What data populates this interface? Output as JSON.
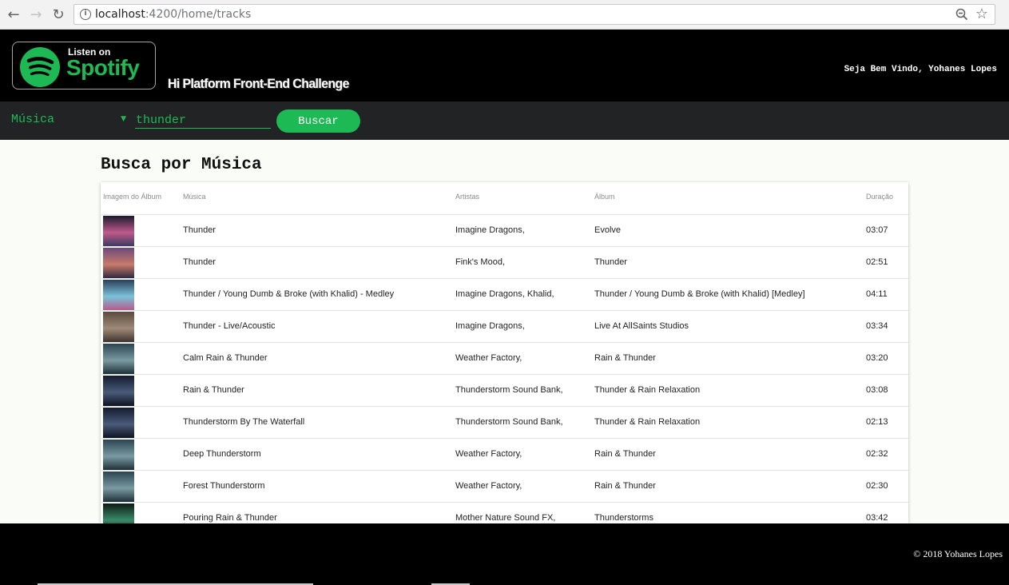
{
  "browser": {
    "url_host": "localhost",
    "url_path": ":4200/home/tracks"
  },
  "header": {
    "badge_small": "Listen on",
    "badge_big": "Spotify",
    "title": "Hi Platform Front-End Challenge",
    "welcome": "Seja Bem Vindo, Yohanes Lopes"
  },
  "search": {
    "type_selected": "Música",
    "query": "thunder",
    "button_label": "Buscar"
  },
  "main": {
    "title": "Busca por Música",
    "columns": [
      "Imagem do Álbum",
      "Música",
      "Artistas",
      "Álbum",
      "Duração"
    ],
    "rows": [
      {
        "name": "Thunder",
        "artists": "Imagine Dragons,",
        "album": "Evolve",
        "duration": "03:07",
        "thumb": [
          "#1a1a2e",
          "#c05a8a",
          "#3a3a60"
        ]
      },
      {
        "name": "Thunder",
        "artists": "Fink's Mood,",
        "album": "Thunder",
        "duration": "02:51",
        "thumb": [
          "#6a4a7a",
          "#c97a6a",
          "#2e2a40"
        ]
      },
      {
        "name": "Thunder / Young Dumb & Broke (with Khalid) - Medley",
        "artists": "Imagine Dragons, Khalid,",
        "album": "Thunder / Young Dumb & Broke (with Khalid) [Medley]",
        "duration": "04:11",
        "thumb": [
          "#2a3f5a",
          "#79c3d8",
          "#b85a8a"
        ]
      },
      {
        "name": "Thunder - Live/Acoustic",
        "artists": "Imagine Dragons,",
        "album": "Live At AllSaints Studios",
        "duration": "03:34",
        "thumb": [
          "#5a4a3e",
          "#a08a78",
          "#3e3430"
        ]
      },
      {
        "name": "Calm Rain & Thunder",
        "artists": "Weather Factory,",
        "album": "Rain & Thunder",
        "duration": "03:20",
        "thumb": [
          "#2b4550",
          "#7a9aa2",
          "#1e3038"
        ]
      },
      {
        "name": "Rain & Thunder",
        "artists": "Thunderstorm Sound Bank,",
        "album": "Thunder & Rain Relaxation",
        "duration": "03:08",
        "thumb": [
          "#141c2e",
          "#4a5a7a",
          "#0e1420"
        ]
      },
      {
        "name": "Thunderstorm By The Waterfall",
        "artists": "Thunderstorm Sound Bank,",
        "album": "Thunder & Rain Relaxation",
        "duration": "02:13",
        "thumb": [
          "#141c2e",
          "#4a5a7a",
          "#0e1420"
        ]
      },
      {
        "name": "Deep Thunderstorm",
        "artists": "Weather Factory,",
        "album": "Rain & Thunder",
        "duration": "02:32",
        "thumb": [
          "#2b4550",
          "#7a9aa2",
          "#1e3038"
        ]
      },
      {
        "name": "Forest Thunderstorm",
        "artists": "Weather Factory,",
        "album": "Rain & Thunder",
        "duration": "02:30",
        "thumb": [
          "#2b4550",
          "#7a9aa2",
          "#1e3038"
        ]
      },
      {
        "name": "Pouring Rain & Thunder",
        "artists": "Mother Nature Sound FX,",
        "album": "Thunderstorms",
        "duration": "03:42",
        "thumb": [
          "#0c1a14",
          "#3a8a6a",
          "#0a120e"
        ]
      }
    ]
  },
  "footer": {
    "copyright": "© 2018 Yohanes Lopes"
  },
  "colors": {
    "brand_green": "#1db954",
    "header_bg": "#000000",
    "searchbar_bg": "#212325"
  }
}
